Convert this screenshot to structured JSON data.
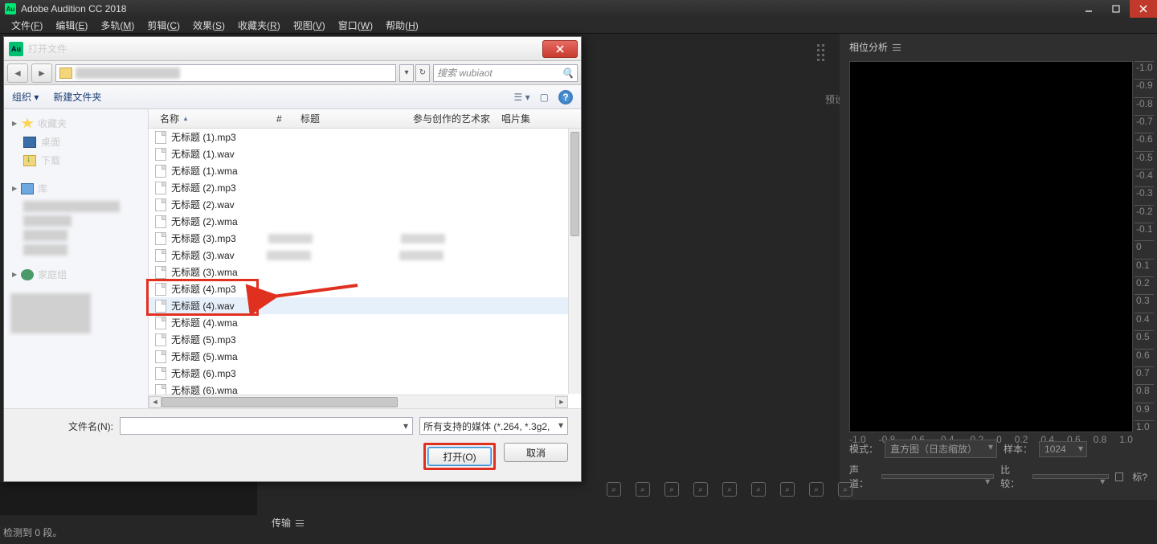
{
  "app": {
    "title": "Adobe Audition CC 2018",
    "icon_text": "Au"
  },
  "menubar": [
    {
      "label": "文件",
      "accel": "F"
    },
    {
      "label": "编辑",
      "accel": "E"
    },
    {
      "label": "多轨",
      "accel": "M"
    },
    {
      "label": "剪辑",
      "accel": "C"
    },
    {
      "label": "效果",
      "accel": "S"
    },
    {
      "label": "收藏夹",
      "accel": "R"
    },
    {
      "label": "视图",
      "accel": "V"
    },
    {
      "label": "窗口",
      "accel": "W"
    },
    {
      "label": "帮助",
      "accel": "H"
    }
  ],
  "dialog": {
    "title": "打开文件",
    "icon_text": "Au",
    "search_placeholder": "搜索 wubiaot",
    "toolbar": {
      "organize": "组织 ▾",
      "new_folder": "新建文件夹"
    },
    "columns": {
      "name": "名称",
      "number": "#",
      "title": "标题",
      "artist": "参与创作的艺术家",
      "album": "唱片集"
    },
    "sidebar": {
      "favorites": "收藏夹",
      "desktop": "桌面",
      "downloads": "下载",
      "library": "库",
      "homegroup": "家庭组"
    },
    "files": [
      {
        "name": "无标题 (1).mp3",
        "blur": false
      },
      {
        "name": "无标题 (1).wav",
        "blur": false
      },
      {
        "name": "无标题 (1).wma",
        "blur": false
      },
      {
        "name": "无标题 (2).mp3",
        "blur": false
      },
      {
        "name": "无标题 (2).wav",
        "blur": false
      },
      {
        "name": "无标题 (2).wma",
        "blur": false
      },
      {
        "name": "无标题 (3).mp3",
        "blur": true
      },
      {
        "name": "无标题 (3).wav",
        "blur": true
      },
      {
        "name": "无标题 (3).wma",
        "blur": false
      },
      {
        "name": "无标题 (4).mp3",
        "blur": false
      },
      {
        "name": "无标题 (4).wav",
        "blur": false,
        "selected": true,
        "highlighted": true
      },
      {
        "name": "无标题 (4).wma",
        "blur": false
      },
      {
        "name": "无标题 (5).mp3",
        "blur": false
      },
      {
        "name": "无标题 (5).wma",
        "blur": false
      },
      {
        "name": "无标题 (6).mp3",
        "blur": false
      },
      {
        "name": "无标题 (6).wma",
        "blur": false
      }
    ],
    "footer": {
      "filename_label": "文件名(N):",
      "filter_label": "所有支持的媒体 (*.264, *.3g2,",
      "open": "打开(O)",
      "cancel": "取消"
    }
  },
  "phase_panel": {
    "title": "相位分析",
    "ticks_v": [
      "-1.0",
      "-0.9",
      "-0.8",
      "-0.7",
      "-0.6",
      "-0.5",
      "-0.4",
      "-0.3",
      "-0.2",
      "-0.1",
      "0",
      "0.1",
      "0.2",
      "0.3",
      "0.4",
      "0.5",
      "0.6",
      "0.7",
      "0.8",
      "0.9",
      "1.0"
    ],
    "ticks_h": [
      "-1.0",
      "-0.8",
      "-0.6",
      "-0.4",
      "-0.2",
      "0",
      "0.2",
      "0.4",
      "0.6",
      "0.8",
      "1.0"
    ],
    "mode_label": "模式：",
    "mode_value": "直方图（日志缩放）",
    "sample_label": "样本：",
    "sample_value": "1024",
    "channel_label": "声道：",
    "channel_value": "",
    "compare_label": "比较：",
    "compare_value": "",
    "annot": "标?"
  },
  "transport_label": "传输",
  "status_left": "检测到 0 段。",
  "right_slim_label": "预设"
}
